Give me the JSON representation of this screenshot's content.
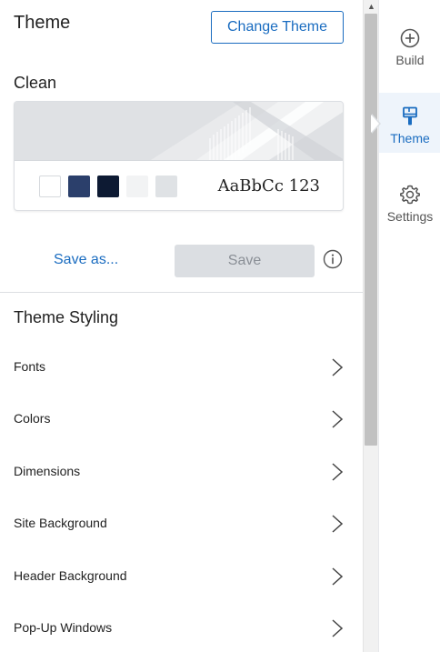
{
  "panel": {
    "title": "Theme",
    "change_theme_label": "Change Theme",
    "current_theme_name": "Clean",
    "sample_text": "AaBbCc 123",
    "swatches": [
      "#ffffff",
      "#2b3f6b",
      "#0d1a33",
      "#f2f3f4",
      "#dfe2e5"
    ],
    "save_as_label": "Save as...",
    "save_label": "Save",
    "save_enabled": false
  },
  "styling": {
    "title": "Theme Styling",
    "items": [
      {
        "label": "Fonts"
      },
      {
        "label": "Colors"
      },
      {
        "label": "Dimensions"
      },
      {
        "label": "Site Background"
      },
      {
        "label": "Header Background"
      },
      {
        "label": "Pop-Up Windows"
      }
    ]
  },
  "rail": {
    "items": [
      {
        "label": "Build",
        "icon": "plus-circle-icon",
        "active": false
      },
      {
        "label": "Theme",
        "icon": "paintbrush-icon",
        "active": true
      },
      {
        "label": "Settings",
        "icon": "gear-icon",
        "active": false
      }
    ]
  },
  "colors": {
    "accent": "#1a6cc0",
    "disabled_bg": "#dbdee2",
    "disabled_text": "#8a8f96",
    "active_rail_bg": "#eef4fb"
  }
}
